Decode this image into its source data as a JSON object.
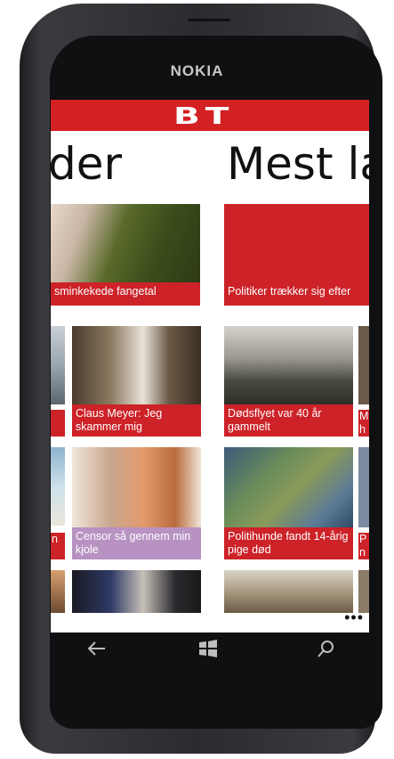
{
  "device": {
    "brand": "NOKIA"
  },
  "app": {
    "logo": "BT"
  },
  "panels": [
    {
      "title": "der"
    },
    {
      "title": "Mest læ"
    }
  ],
  "tiles": {
    "hero_left": "sminkekede fangetal",
    "hero_right": "Politiker trækker sig efter",
    "claus": "Claus Meyer: Jeg skammer mig",
    "dodsflyet": "Dødsflyet var 40 år gammelt",
    "censor": "Censor så gennem min kjole",
    "politihunde": "Politihunde fandt 14-årig pige død",
    "edge1": "M h",
    "edge2": "P n",
    "edge3": "n"
  },
  "appbar": {
    "more": "•••"
  },
  "nav": {
    "back": "back-icon",
    "windows": "windows-icon",
    "search": "search-icon"
  }
}
